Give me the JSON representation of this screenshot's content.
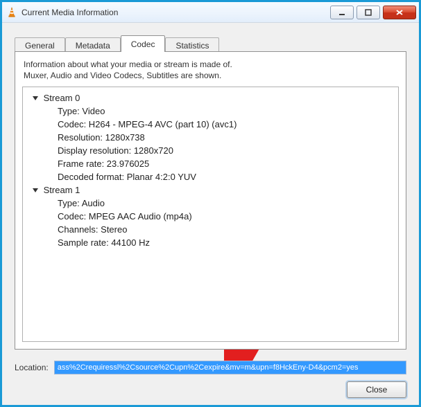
{
  "window": {
    "title": "Current Media Information"
  },
  "tabs": {
    "general": "General",
    "metadata": "Metadata",
    "codec": "Codec",
    "statistics": "Statistics"
  },
  "codec_page": {
    "hint_line1": "Information about what your media or stream is made of.",
    "hint_line2": "Muxer, Audio and Video Codecs, Subtitles are shown."
  },
  "streams": [
    {
      "name": "Stream 0",
      "props": {
        "type": "Type: Video",
        "codec": "Codec: H264 - MPEG-4 AVC (part 10) (avc1)",
        "res": "Resolution: 1280x738",
        "dres": "Display resolution: 1280x720",
        "fps": "Frame rate: 23.976025",
        "decfmt": "Decoded format: Planar 4:2:0 YUV"
      }
    },
    {
      "name": "Stream 1",
      "props": {
        "type": "Type: Audio",
        "codec": "Codec: MPEG AAC Audio (mp4a)",
        "chan": "Channels: Stereo",
        "srate": "Sample rate: 44100 Hz"
      }
    }
  ],
  "location": {
    "label": "Location:",
    "value": "ass%2Crequiressl%2Csource%2Cupn%2Cexpire&mv=m&upn=f8HckEny-D4&pcm2=yes"
  },
  "buttons": {
    "close": "Close"
  }
}
